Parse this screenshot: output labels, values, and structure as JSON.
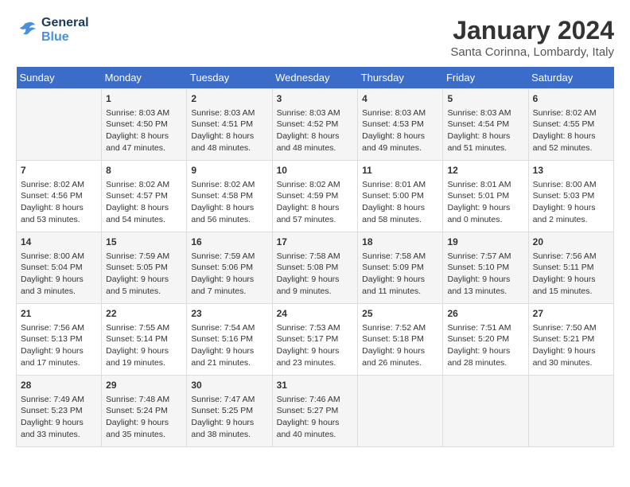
{
  "header": {
    "logo_line1": "General",
    "logo_line2": "Blue",
    "month": "January 2024",
    "location": "Santa Corinna, Lombardy, Italy"
  },
  "days_of_week": [
    "Sunday",
    "Monday",
    "Tuesday",
    "Wednesday",
    "Thursday",
    "Friday",
    "Saturday"
  ],
  "weeks": [
    [
      {
        "day": "",
        "info": ""
      },
      {
        "day": "1",
        "info": "Sunrise: 8:03 AM\nSunset: 4:50 PM\nDaylight: 8 hours\nand 47 minutes."
      },
      {
        "day": "2",
        "info": "Sunrise: 8:03 AM\nSunset: 4:51 PM\nDaylight: 8 hours\nand 48 minutes."
      },
      {
        "day": "3",
        "info": "Sunrise: 8:03 AM\nSunset: 4:52 PM\nDaylight: 8 hours\nand 48 minutes."
      },
      {
        "day": "4",
        "info": "Sunrise: 8:03 AM\nSunset: 4:53 PM\nDaylight: 8 hours\nand 49 minutes."
      },
      {
        "day": "5",
        "info": "Sunrise: 8:03 AM\nSunset: 4:54 PM\nDaylight: 8 hours\nand 51 minutes."
      },
      {
        "day": "6",
        "info": "Sunrise: 8:02 AM\nSunset: 4:55 PM\nDaylight: 8 hours\nand 52 minutes."
      }
    ],
    [
      {
        "day": "7",
        "info": "Sunrise: 8:02 AM\nSunset: 4:56 PM\nDaylight: 8 hours\nand 53 minutes."
      },
      {
        "day": "8",
        "info": "Sunrise: 8:02 AM\nSunset: 4:57 PM\nDaylight: 8 hours\nand 54 minutes."
      },
      {
        "day": "9",
        "info": "Sunrise: 8:02 AM\nSunset: 4:58 PM\nDaylight: 8 hours\nand 56 minutes."
      },
      {
        "day": "10",
        "info": "Sunrise: 8:02 AM\nSunset: 4:59 PM\nDaylight: 8 hours\nand 57 minutes."
      },
      {
        "day": "11",
        "info": "Sunrise: 8:01 AM\nSunset: 5:00 PM\nDaylight: 8 hours\nand 58 minutes."
      },
      {
        "day": "12",
        "info": "Sunrise: 8:01 AM\nSunset: 5:01 PM\nDaylight: 9 hours\nand 0 minutes."
      },
      {
        "day": "13",
        "info": "Sunrise: 8:00 AM\nSunset: 5:03 PM\nDaylight: 9 hours\nand 2 minutes."
      }
    ],
    [
      {
        "day": "14",
        "info": "Sunrise: 8:00 AM\nSunset: 5:04 PM\nDaylight: 9 hours\nand 3 minutes."
      },
      {
        "day": "15",
        "info": "Sunrise: 7:59 AM\nSunset: 5:05 PM\nDaylight: 9 hours\nand 5 minutes."
      },
      {
        "day": "16",
        "info": "Sunrise: 7:59 AM\nSunset: 5:06 PM\nDaylight: 9 hours\nand 7 minutes."
      },
      {
        "day": "17",
        "info": "Sunrise: 7:58 AM\nSunset: 5:08 PM\nDaylight: 9 hours\nand 9 minutes."
      },
      {
        "day": "18",
        "info": "Sunrise: 7:58 AM\nSunset: 5:09 PM\nDaylight: 9 hours\nand 11 minutes."
      },
      {
        "day": "19",
        "info": "Sunrise: 7:57 AM\nSunset: 5:10 PM\nDaylight: 9 hours\nand 13 minutes."
      },
      {
        "day": "20",
        "info": "Sunrise: 7:56 AM\nSunset: 5:11 PM\nDaylight: 9 hours\nand 15 minutes."
      }
    ],
    [
      {
        "day": "21",
        "info": "Sunrise: 7:56 AM\nSunset: 5:13 PM\nDaylight: 9 hours\nand 17 minutes."
      },
      {
        "day": "22",
        "info": "Sunrise: 7:55 AM\nSunset: 5:14 PM\nDaylight: 9 hours\nand 19 minutes."
      },
      {
        "day": "23",
        "info": "Sunrise: 7:54 AM\nSunset: 5:16 PM\nDaylight: 9 hours\nand 21 minutes."
      },
      {
        "day": "24",
        "info": "Sunrise: 7:53 AM\nSunset: 5:17 PM\nDaylight: 9 hours\nand 23 minutes."
      },
      {
        "day": "25",
        "info": "Sunrise: 7:52 AM\nSunset: 5:18 PM\nDaylight: 9 hours\nand 26 minutes."
      },
      {
        "day": "26",
        "info": "Sunrise: 7:51 AM\nSunset: 5:20 PM\nDaylight: 9 hours\nand 28 minutes."
      },
      {
        "day": "27",
        "info": "Sunrise: 7:50 AM\nSunset: 5:21 PM\nDaylight: 9 hours\nand 30 minutes."
      }
    ],
    [
      {
        "day": "28",
        "info": "Sunrise: 7:49 AM\nSunset: 5:23 PM\nDaylight: 9 hours\nand 33 minutes."
      },
      {
        "day": "29",
        "info": "Sunrise: 7:48 AM\nSunset: 5:24 PM\nDaylight: 9 hours\nand 35 minutes."
      },
      {
        "day": "30",
        "info": "Sunrise: 7:47 AM\nSunset: 5:25 PM\nDaylight: 9 hours\nand 38 minutes."
      },
      {
        "day": "31",
        "info": "Sunrise: 7:46 AM\nSunset: 5:27 PM\nDaylight: 9 hours\nand 40 minutes."
      },
      {
        "day": "",
        "info": ""
      },
      {
        "day": "",
        "info": ""
      },
      {
        "day": "",
        "info": ""
      }
    ]
  ]
}
